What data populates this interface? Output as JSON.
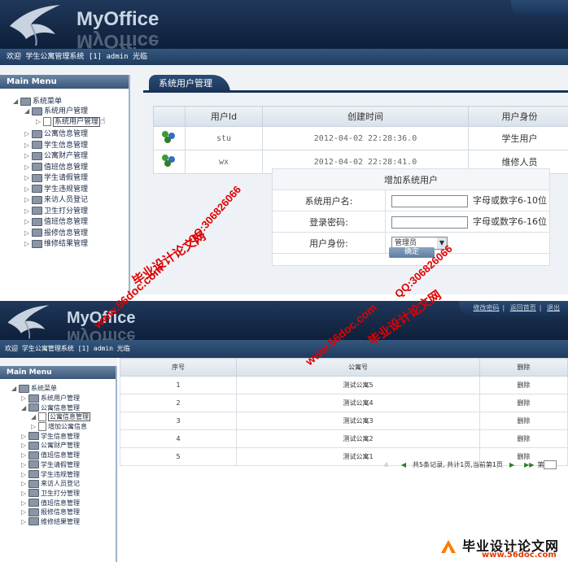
{
  "app": {
    "logo_text": "MyOffice",
    "welcome": "欢迎 学生公寓管理系统 [1] admin 光临"
  },
  "top_links": [
    "修改密码",
    "返回首页",
    "退出"
  ],
  "sidebar": {
    "title": "Main Menu",
    "root": "系统菜单",
    "items": [
      "系统用户管理",
      "公寓信息管理",
      "学生信息管理",
      "公寓财产管理",
      "值班信息管理",
      "学生请假管理",
      "学生违规管理",
      "来访人员登记",
      "卫生打分管理",
      "值班信息管理",
      "报修信息管理",
      "维修结果管理"
    ],
    "sub_user": "系统用户管理",
    "sub_apt": [
      "公寓信息管理",
      "增加公寓信息"
    ]
  },
  "shot1": {
    "tab": "系统用户管理",
    "columns": [
      "用户Id",
      "创建时间",
      "用户身份"
    ],
    "rows": [
      {
        "id": "stu",
        "time": "2012-04-02 22:28:36.0",
        "role": "学生用户"
      },
      {
        "id": "wx",
        "time": "2012-04-02 22:28:41.0",
        "role": "维修人员"
      }
    ],
    "form": {
      "title": "增加系统用户",
      "fields": [
        {
          "label": "系统用户名:",
          "hint": "字母或数字6-10位"
        },
        {
          "label": "登录密码:",
          "hint": "字母或数字6-16位"
        },
        {
          "label": "用户身份:",
          "value": "管理员"
        }
      ],
      "submit": "确定"
    }
  },
  "shot2": {
    "columns": [
      "序号",
      "公寓号",
      "删除"
    ],
    "rows": [
      {
        "no": "1",
        "name": "测试公寓5",
        "op": "删除"
      },
      {
        "no": "2",
        "name": "测试公寓4",
        "op": "删除"
      },
      {
        "no": "3",
        "name": "测试公寓3",
        "op": "删除"
      },
      {
        "no": "4",
        "name": "测试公寓2",
        "op": "删除"
      },
      {
        "no": "5",
        "name": "测试公寓1",
        "op": "删除"
      }
    ],
    "pager": {
      "info": "共5条记录, 共计1页,当前第1页",
      "goto": "第"
    }
  },
  "watermark": {
    "cn": "毕业设计论文网",
    "url": "www.56doc.com",
    "qq": "QQ:306826066",
    "stamp_cn": "毕业设计论文网",
    "stamp_url": "www.56doc.com"
  },
  "colors": {
    "header_dark": "#0d1f3a",
    "tab": "#1a3356",
    "watermark": "#e00000"
  }
}
